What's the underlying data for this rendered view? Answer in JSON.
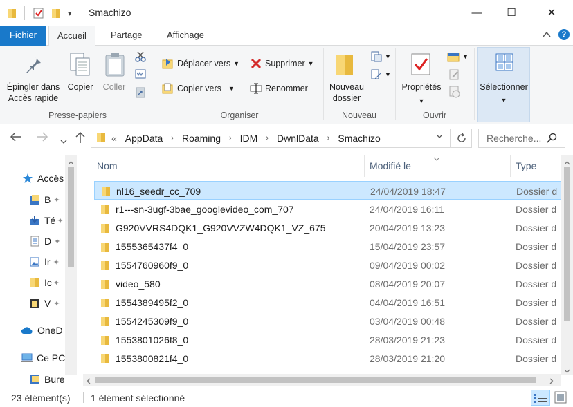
{
  "window": {
    "title": "Smachizo",
    "controls": {
      "minimize": "—",
      "maximize": "☐",
      "close": "✕"
    }
  },
  "quick_access": {
    "dropdown": "▾"
  },
  "ribbon": {
    "tabs": [
      {
        "label": "Fichier"
      },
      {
        "label": "Accueil"
      },
      {
        "label": "Partage"
      },
      {
        "label": "Affichage"
      }
    ],
    "clipboard": {
      "pin_label_1": "Épingler dans",
      "pin_label_2": "Accès rapide",
      "copy_label": "Copier",
      "paste_label": "Coller",
      "group_label": "Presse-papiers"
    },
    "organize": {
      "move_to": "Déplacer vers",
      "copy_to": "Copier vers",
      "delete": "Supprimer",
      "rename": "Renommer",
      "group_label": "Organiser"
    },
    "new": {
      "new_folder_1": "Nouveau",
      "new_folder_2": "dossier",
      "group_label": "Nouveau"
    },
    "open": {
      "properties": "Propriétés",
      "group_label": "Ouvrir"
    },
    "select": {
      "select_label": "Sélectionner"
    }
  },
  "address": {
    "prefix": "«",
    "crumbs": [
      "AppData",
      "Roaming",
      "IDM",
      "DwnlData",
      "Smachizo"
    ],
    "search_placeholder": "Recherche..."
  },
  "navpane": {
    "items": [
      {
        "label": "Accès",
        "icon": "star-icon"
      },
      {
        "label": "B",
        "icon": "folder-icon"
      },
      {
        "label": "Té",
        "icon": "download-icon"
      },
      {
        "label": "D",
        "icon": "document-icon"
      },
      {
        "label": "Ir",
        "icon": "image-icon"
      },
      {
        "label": "Ic",
        "icon": "folder-icon"
      },
      {
        "label": "V",
        "icon": "video-icon"
      },
      {
        "label": "OneD",
        "icon": "cloud-icon"
      },
      {
        "label": "Ce PC",
        "icon": "computer-icon"
      },
      {
        "label": "Bure",
        "icon": "folder-icon"
      }
    ]
  },
  "columns": {
    "name": "Nom",
    "modified": "Modifié le",
    "type": "Type"
  },
  "files": [
    {
      "name": "nl16_seedr_cc_709",
      "date": "24/04/2019 18:47",
      "type": "Dossier d"
    },
    {
      "name": "r1---sn-3ugf-3bae_googlevideo_com_707",
      "date": "24/04/2019 16:11",
      "type": "Dossier d"
    },
    {
      "name": "G920VVRS4DQK1_G920VVZW4DQK1_VZ_675",
      "date": "20/04/2019 13:23",
      "type": "Dossier d"
    },
    {
      "name": "1555365437f4_0",
      "date": "15/04/2019 23:57",
      "type": "Dossier d"
    },
    {
      "name": "1554760960f9_0",
      "date": "09/04/2019 00:02",
      "type": "Dossier d"
    },
    {
      "name": "video_580",
      "date": "08/04/2019 20:07",
      "type": "Dossier d"
    },
    {
      "name": "1554389495f2_0",
      "date": "04/04/2019 16:51",
      "type": "Dossier d"
    },
    {
      "name": "1554245309f9_0",
      "date": "03/04/2019 00:48",
      "type": "Dossier d"
    },
    {
      "name": "1553801026f8_0",
      "date": "28/03/2019 21:23",
      "type": "Dossier d"
    },
    {
      "name": "1553800821f4_0",
      "date": "28/03/2019 21:20",
      "type": "Dossier d"
    }
  ],
  "status": {
    "count": "23 élément(s)",
    "selection": "1 élément sélectionné"
  },
  "colors": {
    "accent": "#1979ca",
    "selected_bg": "#cce8ff",
    "folder": "#f8d775"
  }
}
